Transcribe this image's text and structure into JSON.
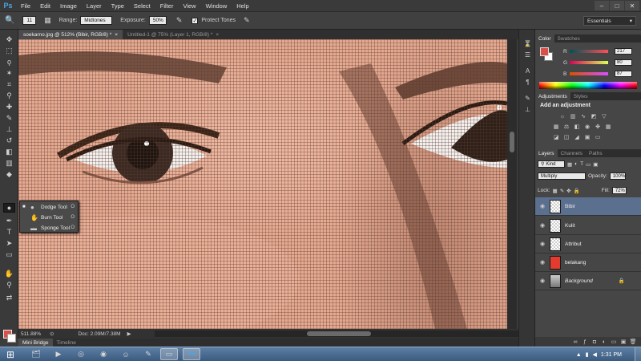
{
  "app": {
    "logo": "Ps"
  },
  "menu": [
    "File",
    "Edit",
    "Image",
    "Layer",
    "Type",
    "Select",
    "Filter",
    "View",
    "Window",
    "Help"
  ],
  "window_controls": {
    "minimize": "–",
    "maximize": "□",
    "close": "✕"
  },
  "options": {
    "brush_size": "11",
    "range_label": "Range:",
    "range_value": "Midtones",
    "exposure_label": "Exposure:",
    "exposure_value": "50%",
    "protect_tones_label": "Protect Tones",
    "protect_tones_checked": "✓",
    "workspace": "Essentials"
  },
  "doc_tabs": [
    {
      "label": "soekarno.jpg @ 512% (Bibir, RGB/8) *",
      "close": "×"
    },
    {
      "label": "Untitled-1 @ 75% (Layer 1, RGB/8) *",
      "close": "×"
    }
  ],
  "flyout": [
    {
      "bullet": "■",
      "label": "Dodge Tool",
      "key": "O"
    },
    {
      "bullet": "",
      "label": "Burn Tool",
      "key": "O"
    },
    {
      "bullet": "",
      "label": "Sponge Tool",
      "key": "O"
    }
  ],
  "status": {
    "zoom": "511.88%",
    "doc": "Doc: 2.09M/7.38M",
    "arrow": "▶"
  },
  "bottom_tabs": [
    "Mini Bridge",
    "Timeline"
  ],
  "color_panel": {
    "tabs": [
      "Color",
      "Swatches"
    ],
    "r_label": "R",
    "r_value": "217",
    "g_label": "G",
    "g_value": "80",
    "b_label": "B",
    "b_value": "87",
    "fg": "#d9504a",
    "bg": "#ffffff"
  },
  "adjustments_panel": {
    "tabs": [
      "Adjustments",
      "Styles"
    ],
    "title": "Add an adjustment"
  },
  "layers_panel": {
    "tabs": [
      "Layers",
      "Channels",
      "Paths"
    ],
    "kind_label": "Kind",
    "blend_mode": "Multiply",
    "opacity_label": "Opacity:",
    "opacity_value": "100%",
    "lock_label": "Lock:",
    "fill_label": "Fill:",
    "fill_value": "72%",
    "layers": [
      {
        "name": "Bibir",
        "thumb": "transparent",
        "selected": true
      },
      {
        "name": "Kulit",
        "thumb": "transparent",
        "selected": false
      },
      {
        "name": "Attribut",
        "thumb": "transparent",
        "selected": false
      },
      {
        "name": "belakang",
        "thumb": "red",
        "selected": false
      },
      {
        "name": "Background",
        "thumb": "photo",
        "selected": false
      }
    ]
  },
  "taskbar": {
    "time": "1:31 PM",
    "apps": [
      "explorer-icon",
      "media-player-icon",
      "chrome-icon",
      "firefox-icon",
      "messenger-icon",
      "tool-icon",
      "folder-icon",
      "photoshop-icon"
    ]
  }
}
